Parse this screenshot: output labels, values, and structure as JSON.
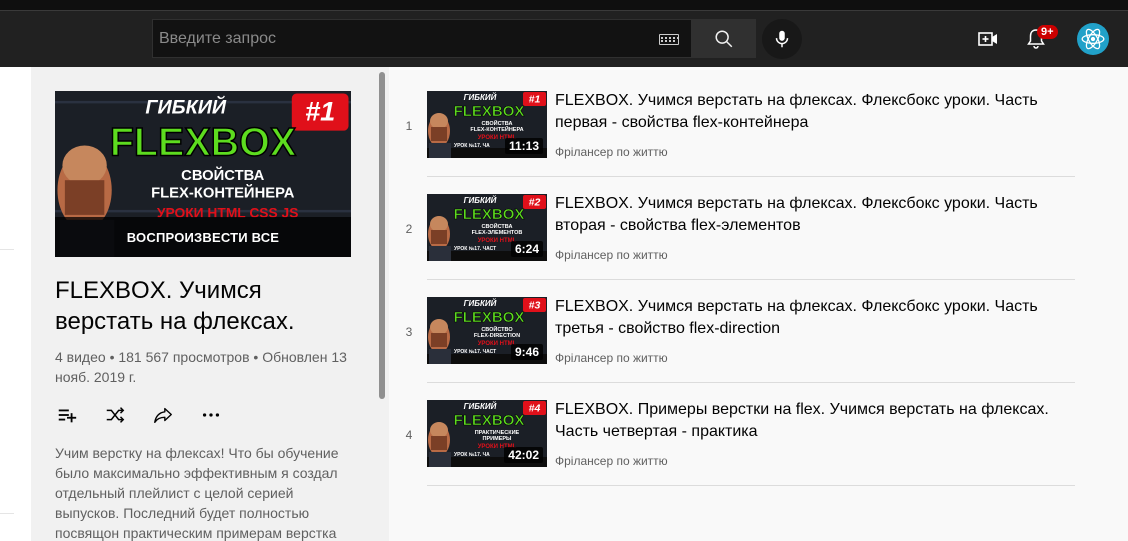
{
  "header": {
    "search_placeholder": "Введите запрос",
    "notification_count": "9+",
    "icons": [
      "keyboard-icon",
      "search-icon",
      "mic-icon",
      "video-create-icon",
      "bell-icon",
      "avatar-react-icon"
    ]
  },
  "playlist": {
    "thumb": {
      "top_text": "ГИБКИЙ",
      "badge": "#1",
      "main_text": "FLEXBOX",
      "sub1": "СВОЙСТВА",
      "sub2": "FLEX-КОНТЕЙНЕРА",
      "sub3": "УРОКИ HTML CSS JS"
    },
    "play_all_label": "ВОСПРОИЗВЕСТИ ВСЕ",
    "title": "FLEXBOX. Учимся верстать на флексах.",
    "stats": "4 видео • 181 567 просмотров • Обновлен 13 нояб. 2019 г.",
    "actions": [
      "add-to-queue-icon",
      "shuffle-icon",
      "share-icon",
      "more-icon"
    ],
    "description": "Учим верстку на флексах! Что бы обучение было максимально эффективным я создал отдельный плейлист с целой серией выпусков. Последний будет полностью посвящон практическим примерам верстка"
  },
  "videos": [
    {
      "index": "1",
      "title": "FLEXBOX. Учимся верстать на флексах. Флексбокс уроки. Часть первая - свойства flex-контейнера",
      "channel": "Фрілансер по життю",
      "duration": "11:13",
      "thumb_top": "ГИБКИЙ",
      "thumb_badge": "#1",
      "thumb_main": "FLEXBOX",
      "thumb_sub1": "СВОЙСТВА",
      "thumb_sub2": "FLEX-КОНТЕЙНЕРА",
      "thumb_sub3": "УРОКИ HTML",
      "thumb_sub4": "УРОК №17. ЧА"
    },
    {
      "index": "2",
      "title": "FLEXBOX. Учимся верстать на флексах. Флексбокс уроки. Часть вторая - свойства flex-элементов",
      "channel": "Фрілансер по життю",
      "duration": "6:24",
      "thumb_top": "ГИБКИЙ",
      "thumb_badge": "#2",
      "thumb_main": "FLEXBOX",
      "thumb_sub1": "СВОЙСТВА",
      "thumb_sub2": "FLEX-ЭЛЕМЕНТОВ",
      "thumb_sub3": "УРОКИ HTML",
      "thumb_sub4": "УРОК №17. ЧАСТ"
    },
    {
      "index": "3",
      "title": "FLEXBOX. Учимся верстать на флексах. Флексбокс уроки. Часть третья - свойство flex-direction",
      "channel": "Фрілансер по життю",
      "duration": "9:46",
      "thumb_top": "ГИБКИЙ",
      "thumb_badge": "#3",
      "thumb_main": "FLEXBOX",
      "thumb_sub1": "СВОЙСТВО",
      "thumb_sub2": "FLEX-DIRECTION",
      "thumb_sub3": "УРОКИ HTML",
      "thumb_sub4": "УРОК №17. ЧАСТ"
    },
    {
      "index": "4",
      "title": "FLEXBOX. Примеры верстки на flex. Учимся верстать на флексах. Часть четвертая - практика",
      "channel": "Фрілансер по життю",
      "duration": "42:02",
      "thumb_top": "ГИБКИЙ",
      "thumb_badge": "#4",
      "thumb_main": "FLEXBOX",
      "thumb_sub1": "ПРАКТИЧЕСКИЕ",
      "thumb_sub2": "ПРИМЕРЫ",
      "thumb_sub3": "УРОКИ HTML",
      "thumb_sub4": "УРОК №17. ЧА"
    }
  ],
  "colors": {
    "topbar": "#212121",
    "flexbox_green": "#5ddc1f",
    "badge_red": "#e0101a",
    "sidebar_bg": "#f1f1f1"
  }
}
